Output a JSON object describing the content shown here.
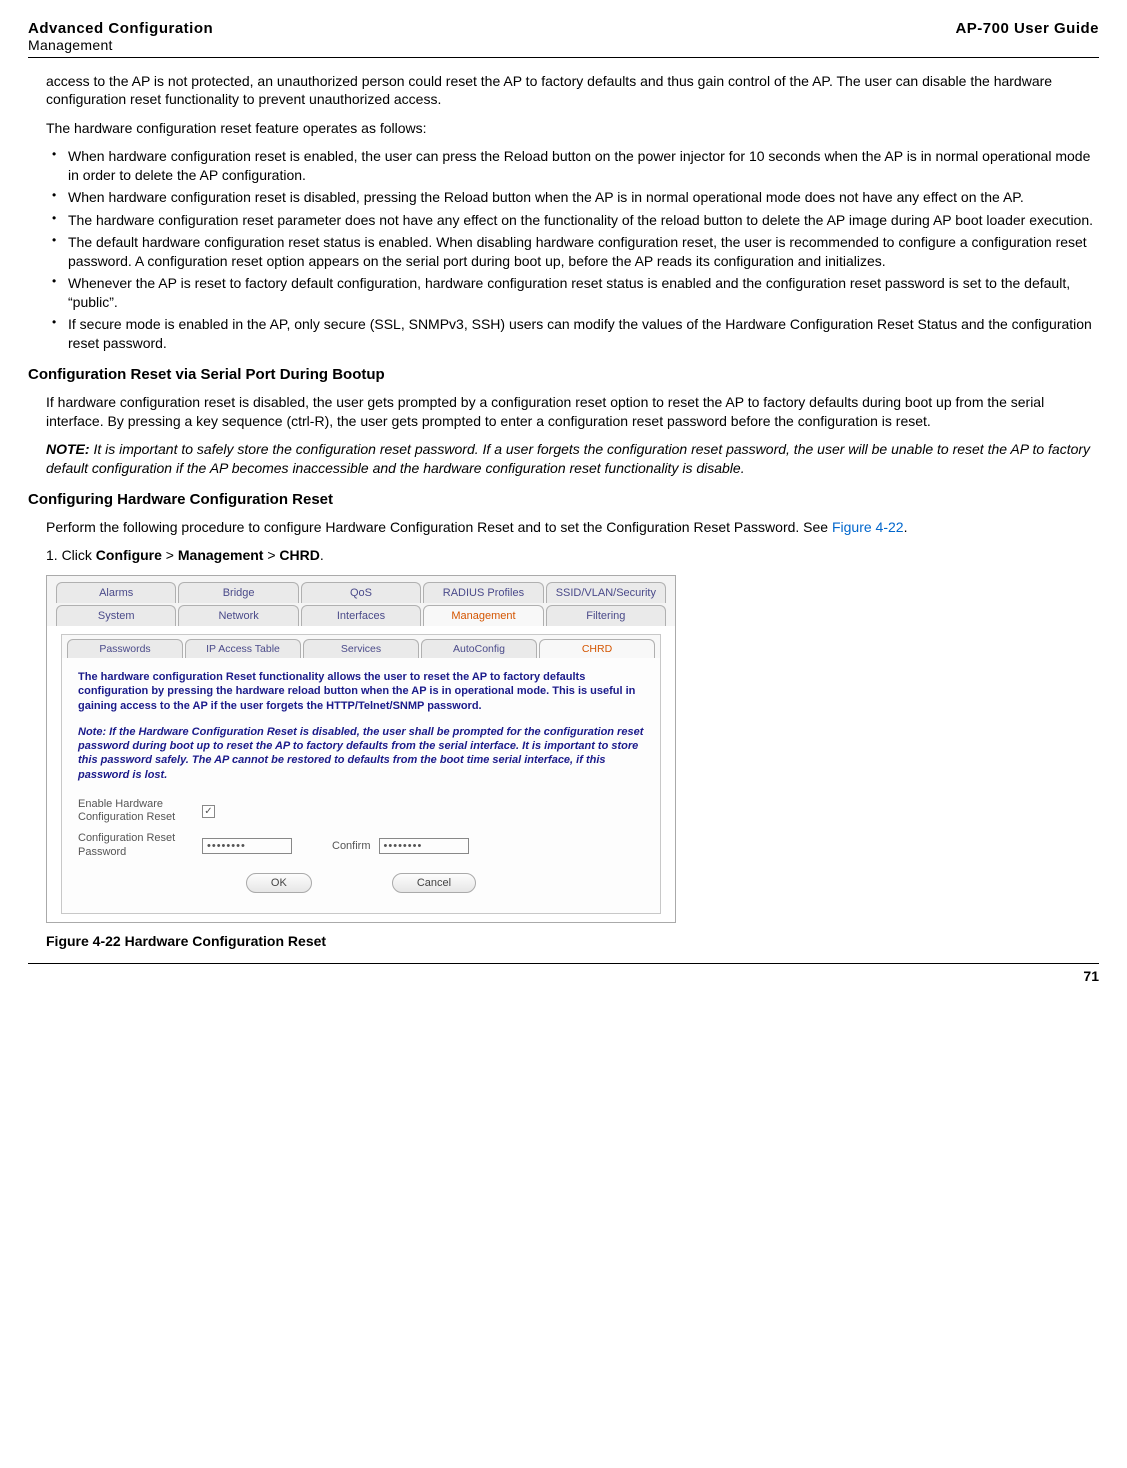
{
  "header": {
    "title": "Advanced Configuration",
    "subtitle": "Management",
    "guide": "AP-700 User Guide"
  },
  "intro": {
    "p1": "access to the AP is not protected, an unauthorized person could reset the AP to factory defaults and thus gain control of the AP. The user can disable the hardware configuration reset functionality to prevent unauthorized access.",
    "p2": "The hardware configuration reset feature operates as follows:"
  },
  "bullets": [
    "When hardware configuration reset is enabled, the user can press the Reload button on the power injector for 10 seconds when the AP is in normal operational mode in order to delete the AP configuration.",
    "When hardware configuration reset is disabled, pressing the Reload button when the AP is in normal operational mode does not have any effect on the AP.",
    "The hardware configuration reset parameter does not have any effect on the functionality of the reload button to delete the AP image during AP boot loader execution.",
    "The default hardware configuration reset status is enabled. When disabling hardware configuration reset, the user is recommended to configure a configuration reset password. A configuration reset option appears on the serial port during boot up, before the AP reads its configuration and initializes.",
    "Whenever the AP is reset to factory default configuration, hardware configuration reset status is enabled and the configuration reset password is set to the default, “public”.",
    "If secure mode is enabled in the AP, only secure (SSL, SNMPv3, SSH) users can modify the values of the Hardware Configuration Reset Status and the configuration reset password."
  ],
  "section1": {
    "title": "Configuration Reset via Serial Port During Bootup",
    "p1": "If hardware configuration reset is disabled, the user gets prompted by a configuration reset option to reset the AP to factory defaults during boot up from the serial interface. By pressing a key sequence (ctrl-R), the user gets prompted to enter a configuration reset password before the configuration is reset.",
    "note_label": "NOTE:",
    "note_text": "It is important to safely store the configuration reset password. If a user forgets the configuration reset password, the user will be unable to reset the AP to factory default configuration if the AP becomes inaccessible and the hardware configuration reset functionality is disable."
  },
  "section2": {
    "title": "Configuring Hardware Configuration Reset",
    "p1_pre": "Perform the following procedure to configure Hardware Configuration Reset and to set the Configuration Reset Password. See ",
    "p1_link": "Figure 4-22",
    "p1_post": ".",
    "step1_pre": "1.  Click ",
    "step1_b1": "Configure",
    "step1_s1": " > ",
    "step1_b2": "Management",
    "step1_s2": " > ",
    "step1_b3": "CHRD",
    "step1_post": "."
  },
  "screenshot": {
    "top_tabs": [
      "Alarms",
      "Bridge",
      "QoS",
      "RADIUS Profiles",
      "SSID/VLAN/Security"
    ],
    "sub_tabs": [
      "System",
      "Network",
      "Interfaces",
      "Management",
      "Filtering"
    ],
    "sub_tabs_active": 3,
    "inner_tabs": [
      "Passwords",
      "IP Access Table",
      "Services",
      "AutoConfig",
      "CHRD"
    ],
    "inner_tabs_active": 4,
    "panel_text": "The hardware configuration Reset functionality allows the user to reset the AP to factory defaults configuration by pressing the hardware reload button when the AP is in operational mode. This is useful in gaining access to the AP if the user forgets the HTTP/Telnet/SNMP password.",
    "panel_note": "Note: If the Hardware Configuration Reset is disabled, the user shall be prompted for the configuration reset password during boot up to reset the AP to factory defaults from the serial interface. It is important to store this password safely. The AP cannot be restored to defaults from the boot time serial interface, if this password is lost.",
    "label_enable": "Enable Hardware Configuration Reset",
    "checkbox_checked": "✓",
    "label_pw": "Configuration Reset Password",
    "pw_value": "••••••••",
    "label_confirm": "Confirm",
    "confirm_value": "••••••••",
    "btn_ok": "OK",
    "btn_cancel": "Cancel"
  },
  "figure_caption": "Figure 4-22 Hardware Configuration Reset",
  "page_number": "71"
}
